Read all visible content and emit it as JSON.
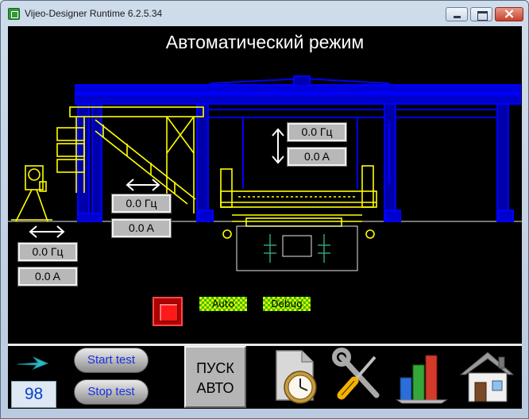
{
  "window": {
    "title": "Vijeo-Designer Runtime 6.2.5.34"
  },
  "screen": {
    "title": "Автоматический режим"
  },
  "readouts": {
    "hoist_freq": "0.0 Гц",
    "hoist_current": "0.0 A",
    "incline_freq": "0.0 Гц",
    "incline_current": "0.0 A",
    "left_freq": "0.0 Гц",
    "left_current": "0.0 A"
  },
  "flags": {
    "auto": "Auto",
    "debug": "Debug"
  },
  "bottom": {
    "counter": "98",
    "start_test": "Start test",
    "stop_test": "Stop test",
    "pusk_line1": "ПУСК",
    "pusk_line2": "АВТО"
  },
  "colors": {
    "frame": "#0000ff",
    "structure": "#ffff00",
    "background": "#000000",
    "alarm": "#ff1a1a",
    "status_green": "#39c000"
  },
  "icons": [
    "arrow-right-icon",
    "clock-document-icon",
    "tools-icon",
    "bar-chart-icon",
    "home-icon"
  ]
}
